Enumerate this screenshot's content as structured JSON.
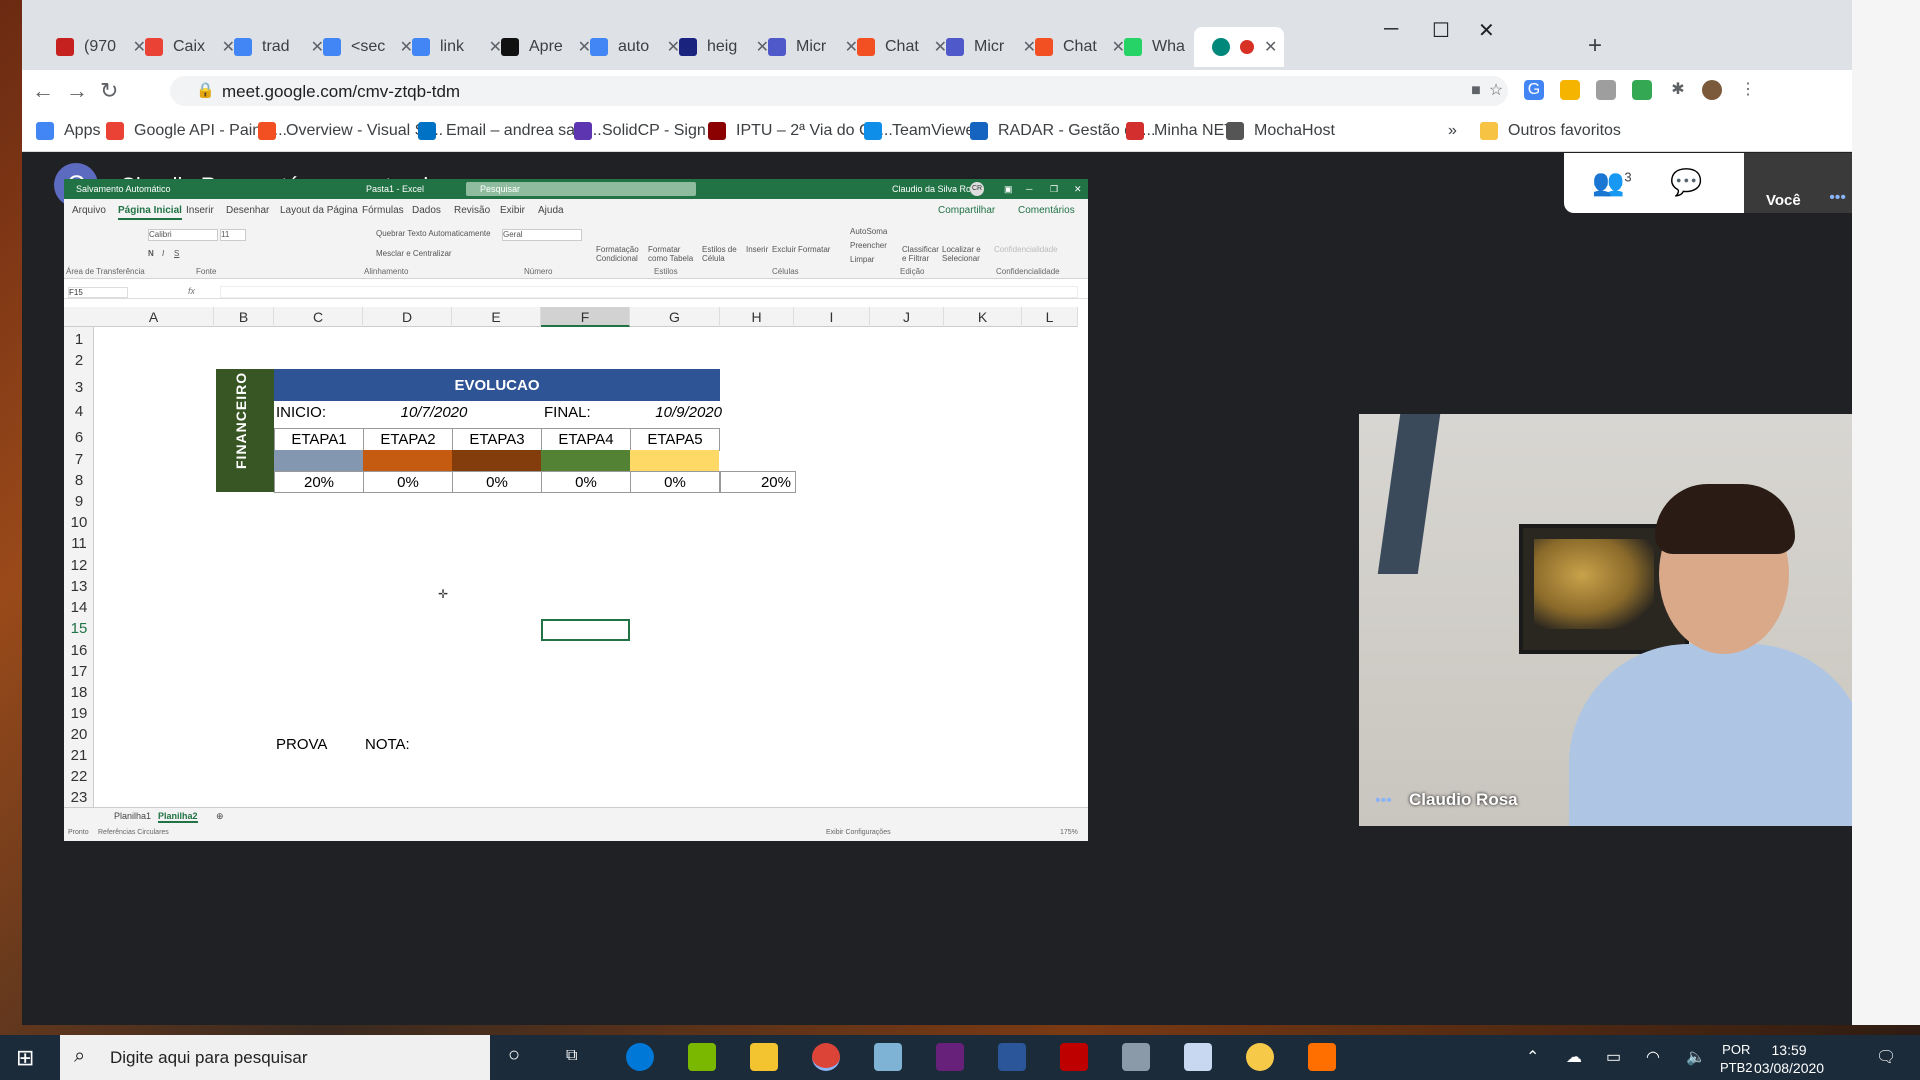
{
  "browser": {
    "tabs": [
      {
        "label": "(970",
        "color": "#c5221f"
      },
      {
        "label": "Caix",
        "color": "#ea4335"
      },
      {
        "label": "trad",
        "color": "#4285f4"
      },
      {
        "label": "<sec",
        "color": "#4285f4"
      },
      {
        "label": "link ",
        "color": "#4285f4"
      },
      {
        "label": "Apre",
        "color": "#111111"
      },
      {
        "label": "auto",
        "color": "#4285f4"
      },
      {
        "label": "heig",
        "color": "#1a237e"
      },
      {
        "label": "Micr",
        "color": "#5059c9"
      },
      {
        "label": "Chat",
        "color": "#f25022"
      },
      {
        "label": "Micr",
        "color": "#5059c9"
      },
      {
        "label": "Chat",
        "color": "#f25022"
      },
      {
        "label": "Wha",
        "color": "#25d366"
      }
    ],
    "url": "meet.google.com/cmv-ztqb-tdm",
    "bookmarks": [
      "Apps",
      "Google API - Painel...",
      "Overview - Visual St...",
      "Email – andrea sant...",
      "SolidCP - Sign In",
      "IPTU – 2ª Via do Ca...",
      "TeamViewer",
      "RADAR - Gestão de...",
      "Minha NET",
      "MochaHost"
    ],
    "bookmarks_more": "»",
    "other_bookmarks": "Outros favoritos"
  },
  "meet": {
    "presenter_initial": "C",
    "presenter_text": "Claudio Rosa está apresentando",
    "participants_count": "3",
    "self_label": "Você",
    "video_name": "Claudio Rosa"
  },
  "excel": {
    "autosave": "Salvamento Automático",
    "file_title": "Pasta1 - Excel",
    "search": "Pesquisar",
    "user": "Claudio da Silva Rosa",
    "user_initials": "CR",
    "menu": [
      "Arquivo",
      "Página Inicial",
      "Inserir",
      "Desenhar",
      "Layout da Página",
      "Fórmulas",
      "Dados",
      "Revisão",
      "Exibir",
      "Ajuda"
    ],
    "share": "Compartilhar",
    "comments": "Comentários",
    "ribbon": {
      "font": "Calibri",
      "size": "11",
      "wrap": "Quebrar Texto Automaticamente",
      "merge": "Mesclar e Centralizar",
      "number_format": "Geral",
      "cond_format": "Formatação Condicional",
      "format_table": "Formatar como Tabela",
      "cell_styles": "Estilos de Célula",
      "insert": "Inserir",
      "delete": "Excluir",
      "format": "Formatar",
      "autosum": "AutoSoma",
      "fill": "Preencher",
      "clear": "Limpar",
      "sort": "Classificar e Filtrar",
      "find": "Localizar e Selecionar",
      "sensitivity": "Confidencialidade",
      "groups": [
        "Área de Transferência",
        "Fonte",
        "Alinhamento",
        "Número",
        "Estilos",
        "Células",
        "Edição",
        "Confidencialidade"
      ]
    },
    "name_box": "F15",
    "columns": [
      "A",
      "B",
      "C",
      "D",
      "E",
      "F",
      "G",
      "H",
      "I",
      "J",
      "K",
      "L"
    ],
    "rows": [
      "1",
      "2",
      "3",
      "4",
      "6",
      "7",
      "8",
      "9",
      "10",
      "11",
      "12",
      "13",
      "14",
      "15",
      "16",
      "17",
      "18",
      "19",
      "20",
      "21",
      "22",
      "23"
    ],
    "sheet": {
      "side_label": "FINANCEIRO",
      "title": "EVOLUCAO",
      "inicio_label": "INICIO:",
      "inicio_date": "10/7/2020",
      "final_label": "FINAL:",
      "final_date": "10/9/2020",
      "stages": [
        "ETAPA1",
        "ETAPA2",
        "ETAPA3",
        "ETAPA4",
        "ETAPA5"
      ],
      "stage_colors": [
        "#8497b0",
        "#c55a11",
        "#833c0b",
        "#548235",
        "#ffd966"
      ],
      "percents": [
        "20%",
        "0%",
        "0%",
        "0%",
        "0%"
      ],
      "total": "20%",
      "prova": "PROVA",
      "nota": "NOTA:"
    },
    "sheet_tabs": [
      "Planilha1",
      "Planilha2"
    ],
    "status_left": "Pronto",
    "status_circular": "Referências Circulares",
    "status_display": "Exibir Configurações",
    "zoom": "175%"
  },
  "taskbar": {
    "search_placeholder": "Digite aqui para pesquisar",
    "lang": "POR",
    "lang2": "PTB2",
    "time": "13:59",
    "date": "03/08/2020"
  }
}
